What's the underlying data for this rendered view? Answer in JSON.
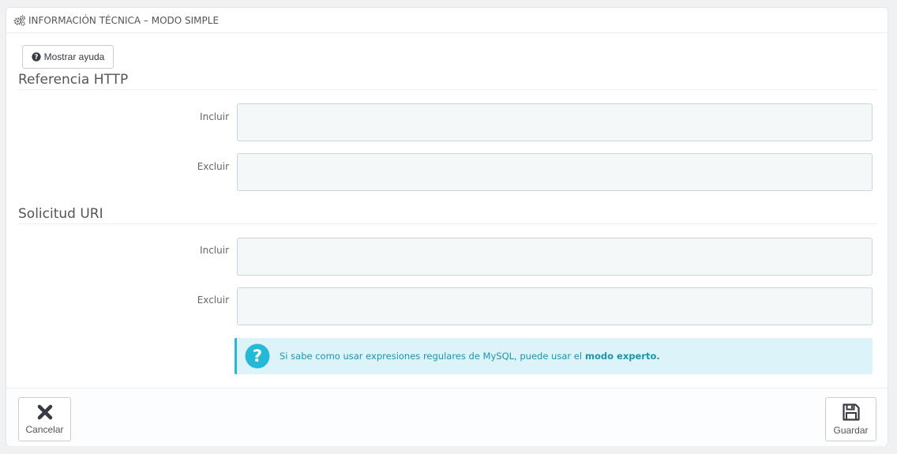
{
  "panel": {
    "title": "INFORMACIÓN TÉCNICA – MODO SIMPLE",
    "title_icon": "gears-icon"
  },
  "help_button": {
    "label": "Mostrar ayuda",
    "icon": "question-circle-icon"
  },
  "sections": [
    {
      "title": "Referencia HTTP",
      "fields": [
        {
          "label": "Incluir",
          "value": ""
        },
        {
          "label": "Excluir",
          "value": ""
        }
      ]
    },
    {
      "title": "Solicitud URI",
      "fields": [
        {
          "label": "Incluir",
          "value": ""
        },
        {
          "label": "Excluir",
          "value": ""
        }
      ]
    }
  ],
  "alert": {
    "icon": "question-icon",
    "text": "Si sabe como usar expresiones regulares de MySQL, puede usar el",
    "link_text": "modo experto."
  },
  "footer": {
    "cancel_label": "Cancelar",
    "cancel_icon": "close-icon",
    "save_label": "Guardar",
    "save_icon": "floppy-disk-icon"
  },
  "colors": {
    "accent": "#25b9d7",
    "alert_bg": "#dcf4f9",
    "alert_text": "#1e94ab",
    "input_bg": "#f5f8f9",
    "input_border": "#c7d6db"
  }
}
